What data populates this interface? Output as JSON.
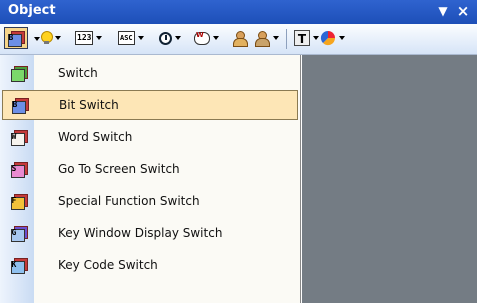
{
  "window": {
    "title": "Object",
    "dropdown_glyph": "▼",
    "close_glyph": "×"
  },
  "toolbar": {
    "switch_tool_letter": "B",
    "numeric_label": "123",
    "ascii_label": "ASC",
    "word_lamp_letter": "W",
    "text_tool_letter": "T"
  },
  "menu": {
    "items": [
      {
        "label": "Switch",
        "letter": "",
        "icon": "switch-icon",
        "back": "#4a9e3a",
        "front": "#7bd86a",
        "selected": false
      },
      {
        "label": "Bit Switch",
        "letter": "B",
        "icon": "bit-switch-icon",
        "back": "#c53a3a",
        "front": "#6c8fe6",
        "selected": true
      },
      {
        "label": "Word Switch",
        "letter": "W",
        "icon": "word-switch-icon",
        "back": "#c53a3a",
        "front": "#f7f4ee",
        "selected": false
      },
      {
        "label": "Go To Screen Switch",
        "letter": "S",
        "icon": "goto-screen-switch-icon",
        "back": "#c53a3a",
        "front": "#e88ad0",
        "selected": false
      },
      {
        "label": "Special Function Switch",
        "letter": "F",
        "icon": "special-function-switch-icon",
        "back": "#c53a3a",
        "front": "#f2c23a",
        "selected": false
      },
      {
        "label": "Key Window Display Switch",
        "letter": "G",
        "icon": "key-window-display-switch-icon",
        "back": "#6b4fd1",
        "front": "#a8c8f0",
        "selected": false
      },
      {
        "label": "Key Code Switch",
        "letter": "K",
        "icon": "key-code-switch-icon",
        "back": "#c53a3a",
        "front": "#8fc0ee",
        "selected": false
      }
    ]
  },
  "colors": {
    "title_bar": "#1d4fb8",
    "selected_item": "#fde6b6",
    "panel": "#747c84"
  }
}
